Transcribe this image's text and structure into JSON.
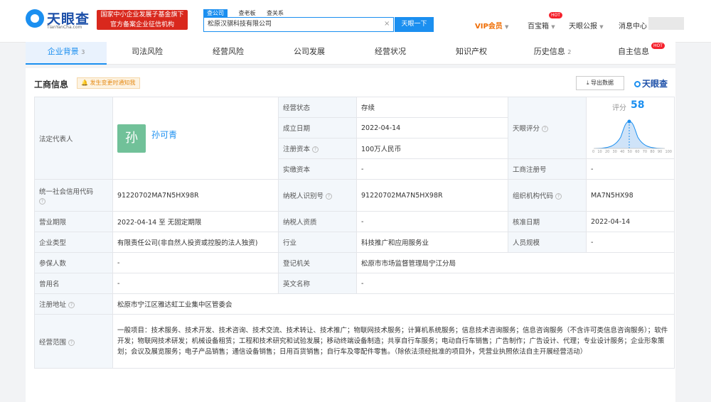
{
  "header": {
    "logo_name": "天眼查",
    "logo_sub": "TianYanCha.com",
    "badge_line1": "国家中小企业发展子基金旗下",
    "badge_line2": "官方备案企业征信机构",
    "search_tabs": [
      "查公司",
      "查老板",
      "查关系"
    ],
    "search_value": "松原汉骐科技有限公司",
    "search_button": "天眼一下",
    "vip": "VIP会员",
    "baibaoxiang": "百宝箱",
    "gongbao": "天眼公报",
    "messages": "消息中心",
    "hot": "HOT"
  },
  "tabs": [
    {
      "label": "企业背景",
      "count": "3"
    },
    {
      "label": "司法风险",
      "count": ""
    },
    {
      "label": "经营风险",
      "count": ""
    },
    {
      "label": "公司发展",
      "count": ""
    },
    {
      "label": "经营状况",
      "count": ""
    },
    {
      "label": "知识产权",
      "count": ""
    },
    {
      "label": "历史信息",
      "count": "2"
    },
    {
      "label": "自主信息",
      "count": ""
    }
  ],
  "section": {
    "title": "工商信息",
    "notify": "发生变更时通知我",
    "export": "导出数据",
    "brand": "天眼查"
  },
  "info": {
    "legal_rep_label": "法定代表人",
    "legal_rep_avatar": "孙",
    "legal_rep_name": "孙可青",
    "status_label": "经营状态",
    "status": "存续",
    "est_label": "成立日期",
    "est": "2022-04-14",
    "capital_label": "注册资本",
    "capital": "100万人民币",
    "paid_label": "实缴资本",
    "paid": "-",
    "score_label": "天眼评分",
    "score_title": "评分",
    "score": "58",
    "score_ticks": [
      "0",
      "10",
      "20",
      "30",
      "40",
      "50",
      "60",
      "70",
      "80",
      "90",
      "100"
    ],
    "reg_no_label": "工商注册号",
    "reg_no": "-",
    "credit_label": "统一社会信用代码",
    "credit": "91220702MA7N5HX98R",
    "taxid_label": "纳税人识别号",
    "taxid": "91220702MA7N5HX98R",
    "orgcode_label": "组织机构代码",
    "orgcode": "MA7N5HX98",
    "term_label": "营业期限",
    "term": "2022-04-14  至 无固定期限",
    "taxq_label": "纳税人资质",
    "taxq": "-",
    "approve_label": "核准日期",
    "approve": "2022-04-14",
    "type_label": "企业类型",
    "type": "有限责任公司(非自然人投资或控股的法人独资)",
    "industry_label": "行业",
    "industry": "科技推广和应用服务业",
    "staff_label": "人员规模",
    "staff": "-",
    "insured_label": "参保人数",
    "insured": "-",
    "authority_label": "登记机关",
    "authority": "松原市市场监督管理局宁江分局",
    "former_label": "曾用名",
    "former": "-",
    "english_label": "英文名称",
    "english": "-",
    "address_label": "注册地址",
    "address": "松原市宁江区雅达虹工业集中区管委会",
    "scope_label": "经营范围",
    "scope": "一般项目：技术服务、技术开发、技术咨询、技术交流、技术转让、技术推广；物联网技术服务；计算机系统服务；信息技术咨询服务；信息咨询服务（不含许可类信息咨询服务）；软件开发；物联网技术研发；机械设备租赁；工程和技术研究和试验发展；移动终端设备制造；共享自行车服务；电动自行车销售；广告制作；广告设计、代理；专业设计服务；企业形象策划；会议及展览服务；电子产品销售；通信设备销售；日用百货销售；自行车及零配件零售。（除依法须经批准的项目外，凭营业执照依法自主开展经营活动）"
  }
}
